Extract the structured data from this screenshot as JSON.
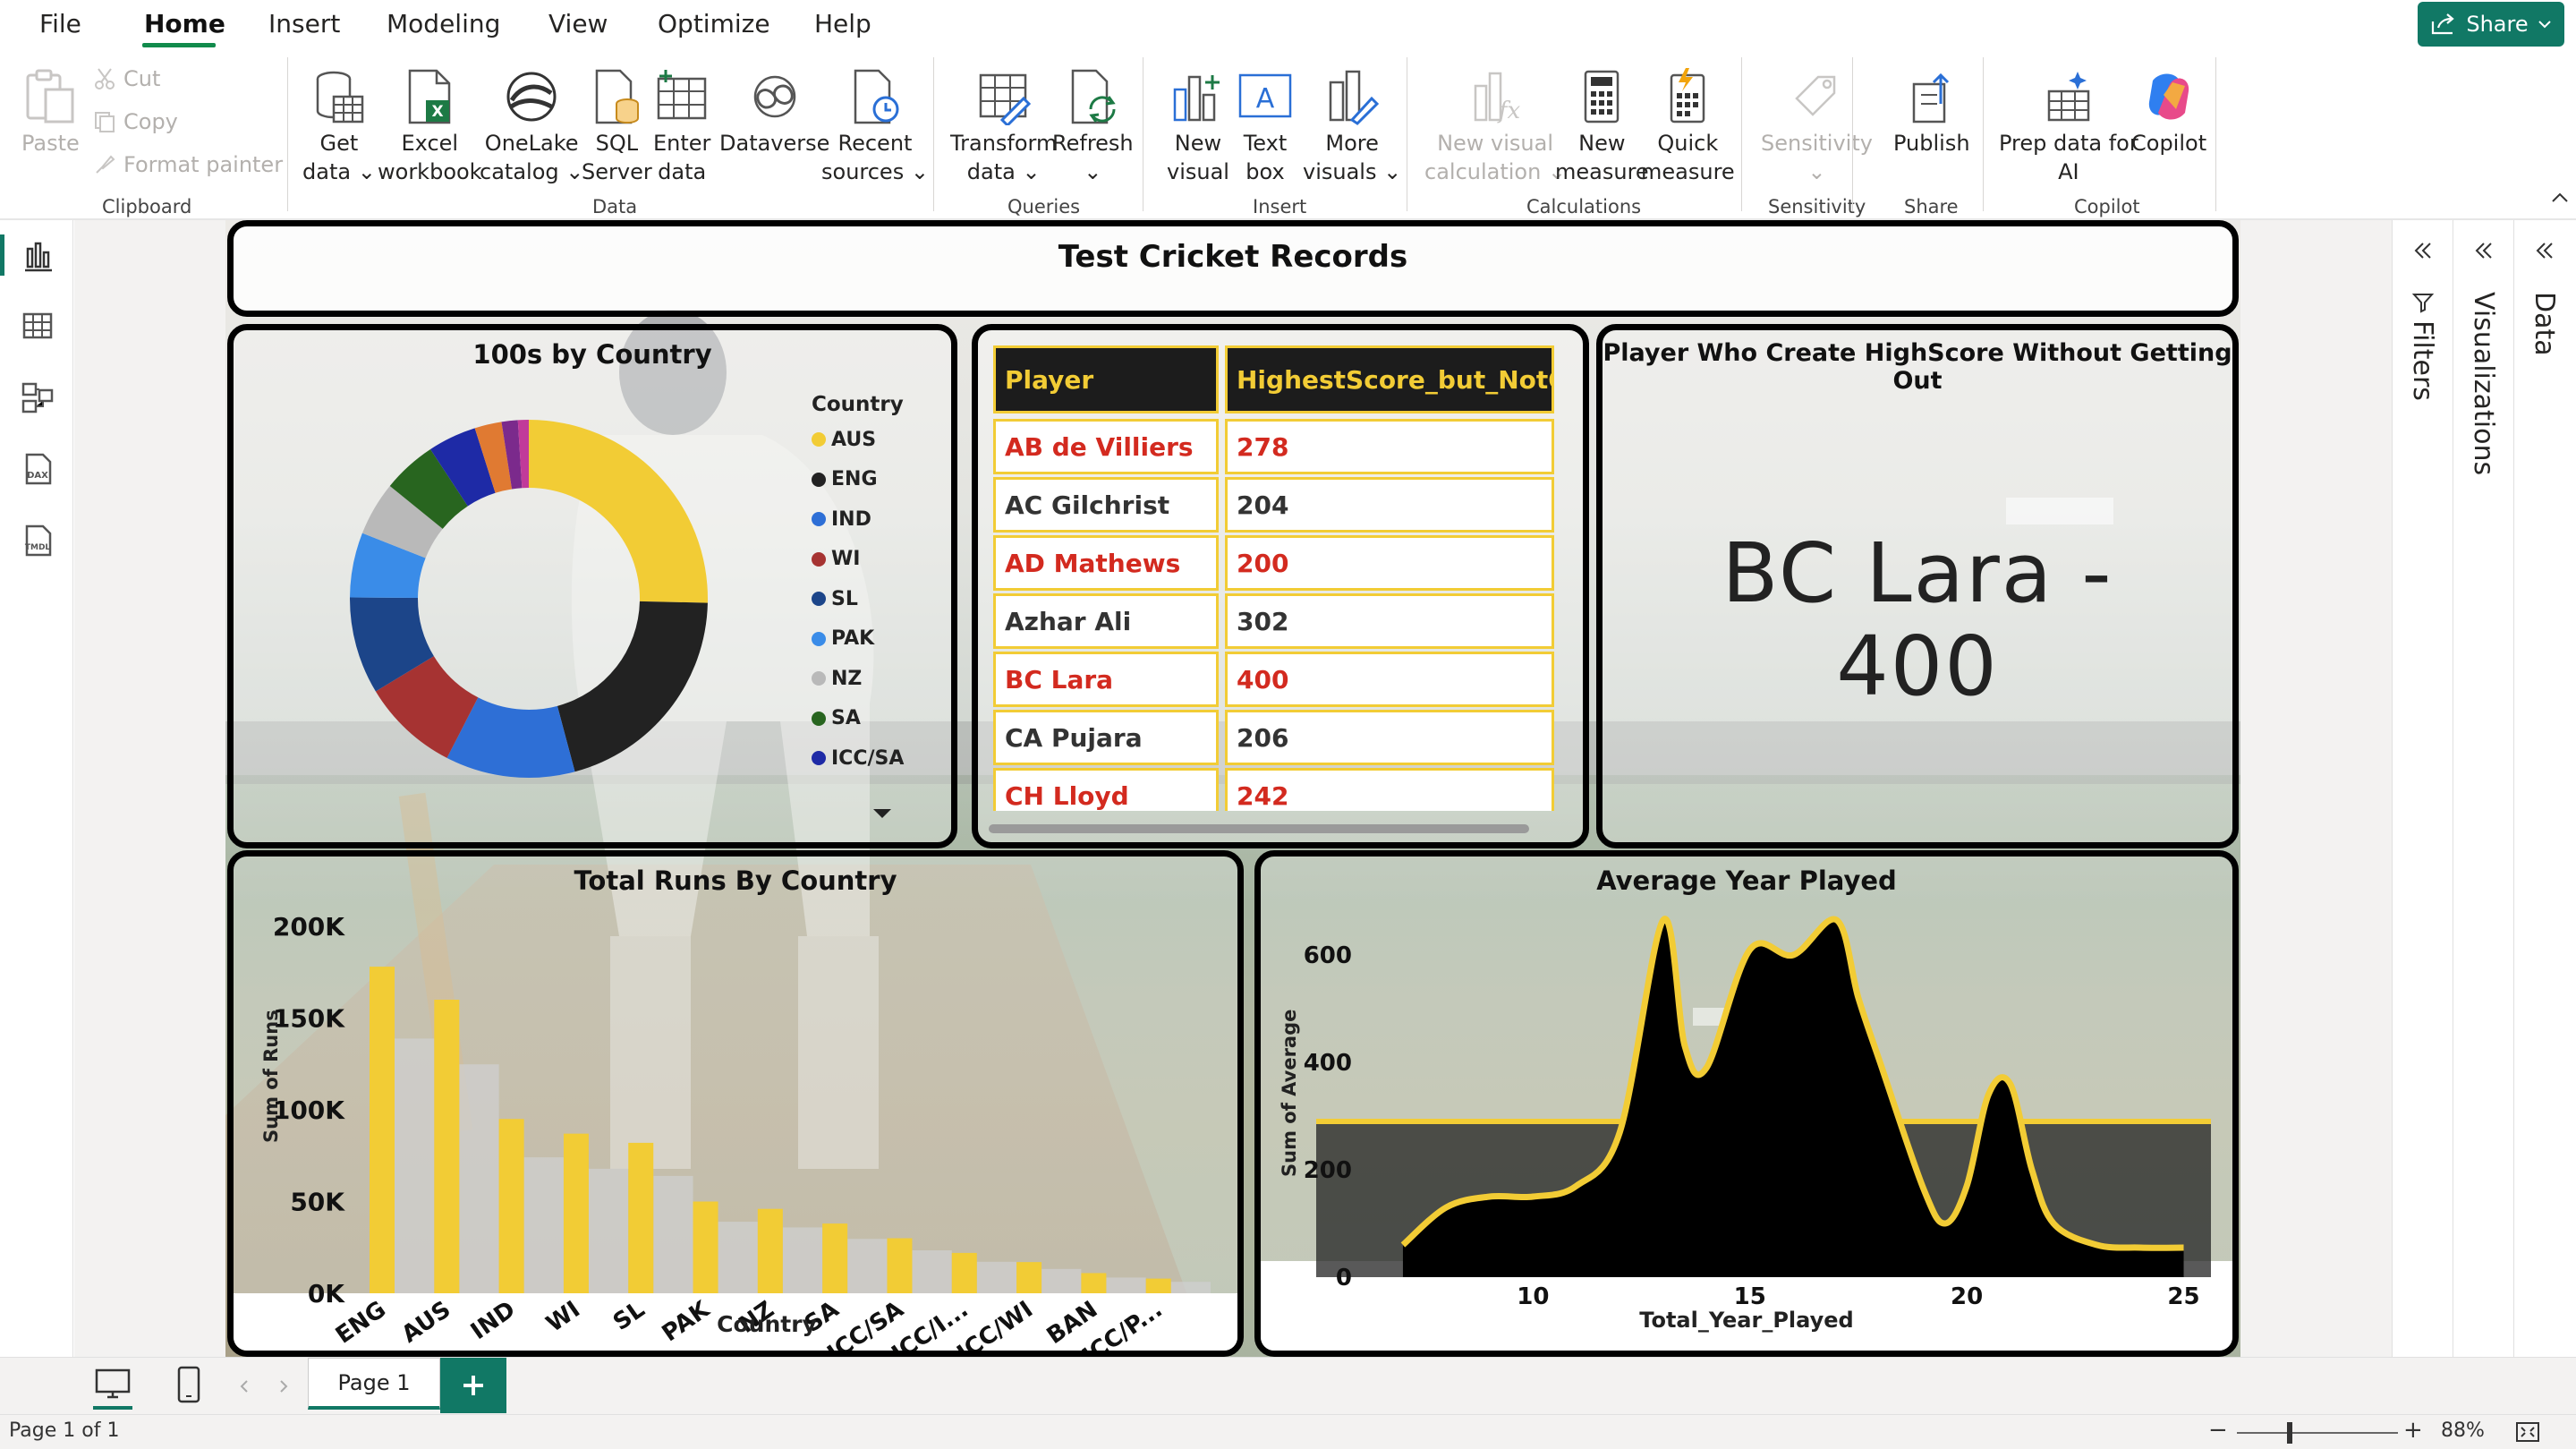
{
  "menu": [
    "File",
    "Home",
    "Insert",
    "Modeling",
    "View",
    "Optimize",
    "Help"
  ],
  "share_label": "Share",
  "ribbon": {
    "clipboard": {
      "paste": "Paste",
      "cut": "Cut",
      "copy": "Copy",
      "format_painter": "Format painter",
      "group": "Clipboard"
    },
    "data": {
      "get_data": [
        "Get",
        "data"
      ],
      "excel": [
        "Excel",
        "workbook"
      ],
      "onelake": [
        "OneLake",
        "catalog"
      ],
      "sql": [
        "SQL",
        "Server"
      ],
      "enter": [
        "Enter",
        "data"
      ],
      "dataverse": "Dataverse",
      "recent": [
        "Recent",
        "sources"
      ],
      "group": "Data"
    },
    "queries": {
      "transform": [
        "Transform",
        "data"
      ],
      "refresh": "Refresh",
      "group": "Queries"
    },
    "insert": {
      "new_visual": [
        "New",
        "visual"
      ],
      "text_box": [
        "Text",
        "box"
      ],
      "more_visuals": [
        "More",
        "visuals"
      ],
      "group": "Insert"
    },
    "calculations": {
      "new_visual_calc": [
        "New visual",
        "calculation"
      ],
      "new_measure": [
        "New",
        "measure"
      ],
      "quick_measure": [
        "Quick",
        "measure"
      ],
      "group": "Calculations"
    },
    "sensitivity": {
      "label": "Sensitivity",
      "group": "Sensitivity"
    },
    "share": {
      "publish": "Publish",
      "group": "Share"
    },
    "copilot": {
      "prep": [
        "Prep data for",
        "AI"
      ],
      "copilot": "Copilot",
      "group": "Copilot"
    }
  },
  "panes": {
    "filters": "Filters",
    "visualizations": "Visualizations",
    "data": "Data"
  },
  "report": {
    "title": "Test Cricket Records",
    "donut": {
      "title": "100s by Country",
      "legend_title": "Country"
    },
    "table": {
      "headers": [
        "Player",
        "HighestScore_but_NotOut"
      ],
      "rows": [
        {
          "player": "AB de Villiers",
          "score": "278",
          "color": "red"
        },
        {
          "player": "AC Gilchrist",
          "score": "204",
          "color": "blk"
        },
        {
          "player": "AD Mathews",
          "score": "200",
          "color": "red"
        },
        {
          "player": "Azhar Ali",
          "score": "302",
          "color": "blk"
        },
        {
          "player": "BC Lara",
          "score": "400",
          "color": "red"
        },
        {
          "player": "CA Pujara",
          "score": "206",
          "color": "blk"
        },
        {
          "player": "CH Lloyd",
          "score": "242",
          "color": "red"
        }
      ]
    },
    "card": {
      "title": "Player Who Create HighScore Without Getting Out",
      "line1": "BC Lara -",
      "line2": "400"
    },
    "bar": {
      "title": "Total Runs By Country",
      "xlabel": "Country",
      "ylabel": "Sum of Runs"
    },
    "area": {
      "title": "Average Year Played",
      "xlabel": "Total_Year_Played",
      "ylabel": "Sum of Average"
    }
  },
  "chart_data": [
    {
      "type": "pie",
      "title": "100s by Country",
      "legend_title": "Country",
      "categories": [
        "AUS",
        "ENG",
        "IND",
        "WI",
        "SL",
        "PAK",
        "NZ",
        "SA",
        "ICC/SA"
      ],
      "values": [
        26,
        21,
        12,
        9,
        9,
        6,
        5,
        5,
        4.5
      ],
      "extra_slices": [
        2.5,
        1.5,
        1
      ],
      "colors": [
        "#f2cc35",
        "#222222",
        "#2e6fd6",
        "#a63332",
        "#1c4589",
        "#3a8ce8",
        "#b9b9b9",
        "#28651f",
        "#1e2aa6"
      ],
      "extra_colors": [
        "#e07a32",
        "#7b2a8c",
        "#c13a9a"
      ]
    },
    {
      "type": "bar",
      "title": "Total Runs By Country",
      "xlabel": "Country",
      "ylabel": "Sum of Runs",
      "categories": [
        "ENG",
        "AUS",
        "IND",
        "WI",
        "SL",
        "PAK",
        "NZ",
        "SA",
        "ICC/SA",
        "ICC/I...",
        "ICC/WI",
        "BAN",
        "ICC/P..."
      ],
      "series": [
        {
          "values": [
            178000,
            160000,
            95000,
            87000,
            82000,
            50000,
            46000,
            38000,
            30000,
            22000,
            17000,
            11000,
            8000
          ]
        }
      ],
      "yticks": [
        "0K",
        "50K",
        "100K",
        "150K",
        "200K"
      ],
      "ylim": [
        0,
        200000
      ],
      "colors": {
        "bar": "#f2cc35",
        "shadow": "#cfcfcf"
      }
    },
    {
      "type": "area",
      "title": "Average Year Played",
      "xlabel": "Total_Year_Played",
      "ylabel": "Sum of Average",
      "x": [
        7,
        8,
        9,
        10,
        11,
        12,
        13,
        13.5,
        14,
        15,
        16,
        17,
        17.5,
        18,
        19,
        19.5,
        20,
        20.5,
        21,
        21.5,
        22,
        23,
        24,
        25
      ],
      "y": [
        60,
        130,
        150,
        150,
        170,
        270,
        665,
        430,
        390,
        610,
        600,
        665,
        520,
        400,
        165,
        100,
        170,
        340,
        360,
        200,
        100,
        60,
        55,
        55
      ],
      "xticks": [
        10,
        15,
        20,
        25
      ],
      "yticks": [
        0,
        200,
        400,
        600
      ],
      "xlim": [
        5,
        26
      ],
      "ylim": [
        0,
        700
      ],
      "reference_line": 290
    }
  ],
  "pages": {
    "current": "Page 1",
    "status": "Page 1 of 1",
    "zoom": "88%"
  }
}
